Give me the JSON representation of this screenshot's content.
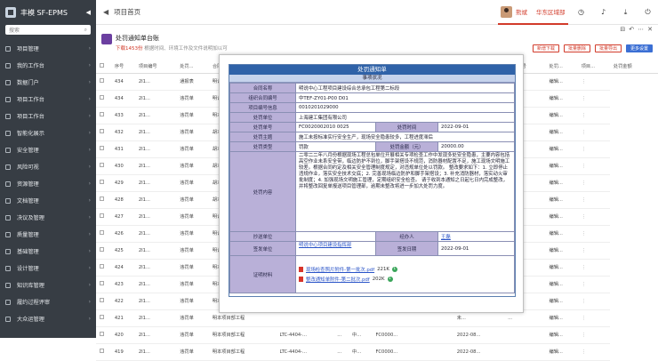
{
  "app": {
    "title": "丰模 SF-EPMS",
    "collapse_glyph": "◀"
  },
  "sidebar": {
    "search_placeholder": "搜索",
    "items": [
      {
        "label": "项目管理"
      },
      {
        "label": "我的工作台"
      },
      {
        "label": "数据门户"
      },
      {
        "label": "项目工作台"
      },
      {
        "label": "项目工作台"
      },
      {
        "label": "智能化展示"
      },
      {
        "label": "安全管理"
      },
      {
        "label": "风险可视"
      },
      {
        "label": "资源管理"
      },
      {
        "label": "文档管理"
      },
      {
        "label": "决议及管理"
      },
      {
        "label": "质量管理"
      },
      {
        "label": "基础管理"
      },
      {
        "label": "设计管理"
      },
      {
        "label": "知识库管理"
      },
      {
        "label": "履约过程评审"
      },
      {
        "label": "大众运管理"
      }
    ]
  },
  "topbar": {
    "back_glyph": "◀",
    "page_title": "项目首页",
    "user_name": "熊斌",
    "dept": "华东区域部",
    "icons": [
      "clock-icon",
      "bell-icon",
      "download-icon",
      "logout-icon"
    ]
  },
  "page": {
    "title": "处罚通知单台账",
    "subtitle_red": "下载1453份",
    "subtitle": "根据时间、环境工作及文件说明加以可",
    "buttons": {
      "b1": "新增下载",
      "b2": "批量删除",
      "b3": "批量导出",
      "b4": "更多设置"
    }
  },
  "table": {
    "headers": [
      "",
      "序号",
      "项目编号",
      "处罚...",
      "合同名称",
      "",
      "",
      "",
      "",
      "",
      "",
      "",
      "",
      "",
      "",
      "处罚编号",
      "处罚...",
      "项目...",
      "处罚金额",
      ""
    ],
    "rows": [
      [
        "434",
        "2I1...",
        "通报表",
        "明说中心项目...",
        "",
        "",
        "",
        "",
        "",
        "",
        "",
        "",
        "",
        "未...",
        "...",
        "编辑..."
      ],
      [
        "434",
        "2I1...",
        "违罚单",
        "明说中心项目部",
        "",
        "",
        "",
        "",
        "",
        "",
        "",
        "",
        "",
        "未...",
        "...",
        "编辑..."
      ],
      [
        "433",
        "2I1...",
        "违罚单",
        "明本项目部工程",
        "",
        "",
        "",
        "",
        "",
        "",
        "",
        "",
        "",
        "未...",
        "...",
        "编辑..."
      ],
      [
        "432",
        "2I1...",
        "违罚单",
        "胡本项目部工程",
        "",
        "",
        "",
        "",
        "",
        "",
        "",
        "",
        "",
        "未...",
        "...",
        "编辑..."
      ],
      [
        "431",
        "2I1...",
        "违罚单",
        "胡本项目部工程",
        "",
        "",
        "",
        "",
        "",
        "",
        "",
        "",
        "",
        "未...",
        "...",
        "编辑..."
      ],
      [
        "430",
        "2I1...",
        "违罚单",
        "胡本项目部工程",
        "",
        "",
        "",
        "",
        "",
        "",
        "",
        "",
        "",
        "未...",
        "...",
        "编辑..."
      ],
      [
        "429",
        "2I1...",
        "违罚单",
        "胡本项目部工程",
        "",
        "",
        "",
        "",
        "",
        "",
        "",
        "",
        "",
        "未...",
        "...",
        "编辑..."
      ],
      [
        "428",
        "2I1...",
        "违罚单",
        "胡本项目部工程",
        "",
        "",
        "",
        "",
        "",
        "",
        "",
        "",
        "",
        "未...",
        "...",
        "编辑..."
      ],
      [
        "427",
        "2I1...",
        "违罚单",
        "明说中心项目部",
        "",
        "",
        "",
        "",
        "",
        "",
        "",
        "",
        "",
        "未...",
        "...",
        "编辑..."
      ],
      [
        "426",
        "2I1...",
        "违罚单",
        "明说中心项目部",
        "",
        "",
        "",
        "",
        "",
        "",
        "",
        "",
        "",
        "未...",
        "...",
        "编辑..."
      ],
      [
        "425",
        "2I1...",
        "违罚单",
        "明说中心项目部",
        "",
        "",
        "",
        "",
        "",
        "",
        "",
        "",
        "",
        "未...",
        "...",
        "编辑..."
      ],
      [
        "424",
        "2I1...",
        "违罚单",
        "明本项目部工程",
        "",
        "",
        "",
        "",
        "",
        "",
        "",
        "",
        "",
        "未...",
        "...",
        "编辑..."
      ],
      [
        "423",
        "2I1...",
        "违罚单",
        "明本项目部工程",
        "",
        "",
        "",
        "",
        "",
        "",
        "",
        "",
        "",
        "未...",
        "...",
        "编辑..."
      ],
      [
        "422",
        "2I1...",
        "违罚单",
        "明本项目部工程",
        "",
        "",
        "",
        "",
        "",
        "",
        "",
        "",
        "",
        "未...",
        "...",
        "编辑..."
      ],
      [
        "421",
        "2I1...",
        "违罚单",
        "明本项目部工程",
        "",
        "",
        "",
        "",
        "",
        "",
        "",
        "",
        "",
        "未...",
        "...",
        "编辑..."
      ],
      [
        "420",
        "2I1...",
        "违罚单",
        "明本项目部工程",
        "LTC-4404-...",
        "...",
        "中...",
        "FC0000...",
        "",
        "",
        "",
        "",
        "",
        "2022-08...",
        "",
        "编辑..."
      ],
      [
        "419",
        "2I1...",
        "违罚单",
        "明本项目部工程",
        "LTC-4404-...",
        "...",
        "中...",
        "FC0000...",
        "",
        "",
        "",
        "",
        "",
        "2022-08...",
        "",
        "编辑..."
      ]
    ]
  },
  "modal": {
    "heading": "处罚通知单",
    "section": "事项状况",
    "fields": {
      "contract_name_label": "合同名称",
      "contract_name": "明说中心工程项目建设综合总承包工程第二标段",
      "project_code_label": "组织合同编号",
      "project_code": "中TEF-ZY01-P00 D01",
      "contract_no_label": "项目编号信息",
      "contract_no": "0010201029000",
      "unit_label": "处罚单位",
      "unit": "上海建工集团有限公司",
      "notice_no_label": "处罚单号",
      "notice_no": "FC0020002010 0025",
      "date_label": "处罚时间",
      "date": "2022-09-01",
      "title_label": "处罚主题",
      "title": "施工未按标准实行安全生产，现场安全隐患较多，工程进度滞后",
      "type_label": "处罚类型",
      "type": "罚款",
      "amount_label": "处罚金额（元）",
      "amount": "20000.00",
      "content_label": "处罚内容",
      "content": "  二零二二年八月份根据现场工程总包单位开展相关专项检查工作中发现多处安全隐患，主要内容包括高空作业未系安全带，临边防护不到位，脚手架搭设不规范，消防器材配置不足，施工现场文明施工较差。根据合同约定及相关安全管理制度规定，对违规单位处以罚款。\n  整改要求如下：1. 立即停止违规作业，落实安全技术交底；2. 完善现场临边防护和脚手架搭设；3. 补充消防器材，落实动火审批制度；4. 加强现场文明施工管理，定期组织安全检查。\n  请于收到本通知之日起七日内完成整改，并将整改回复单报送项目管理部，逾期未整改将进一步加大处罚力度。",
      "remark_label": "抄送单位",
      "remark": "",
      "creator_label": "经办人",
      "creator": "王磊",
      "approver_label": "签发单位",
      "approver": "明说中心项目建设指挥部",
      "send_date_label": "签发日期",
      "send_date": "2022-09-01",
      "attach_label": "证明材料",
      "attach1": "现场检查照片附件-第一批次.pdf",
      "attach1_size": "221K",
      "attach2": "整改通知单附件-第二批次.pdf",
      "attach2_size": "202K"
    }
  },
  "colors": {
    "accent": "#d23b2a",
    "sidebar_bg": "#373d44",
    "label_bg": "#b9b0d8",
    "notice_head": "#2f62a8"
  }
}
